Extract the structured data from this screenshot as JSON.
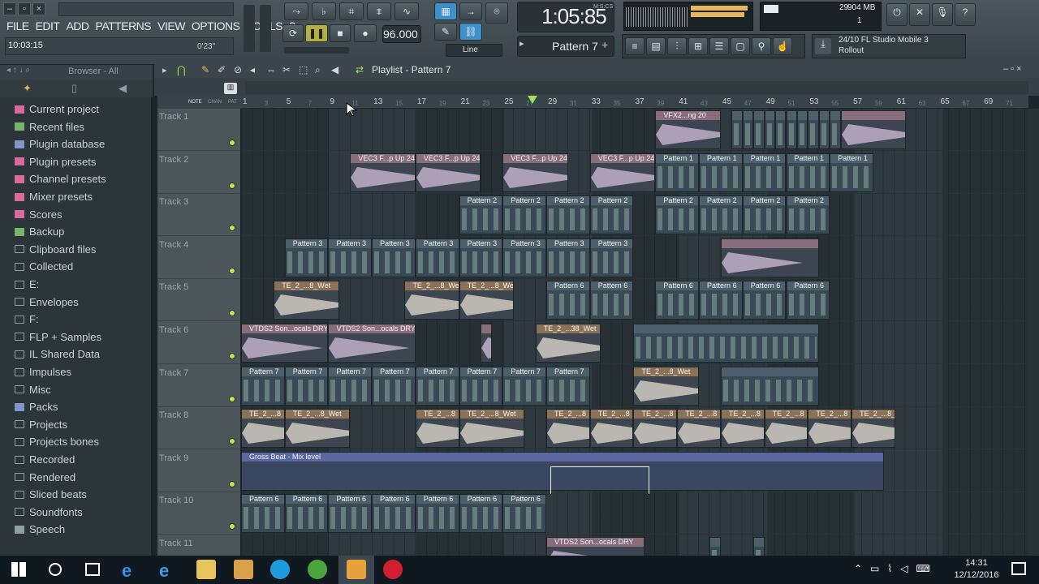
{
  "window": {
    "title": "FL Studio Mobile 3"
  },
  "menu": [
    "FILE",
    "EDIT",
    "ADD",
    "PATTERNS",
    "VIEW",
    "OPTIONS",
    "TOOLS",
    "?"
  ],
  "hint_bar": {
    "time": "10:03:15",
    "duration": "0'23\""
  },
  "transport": {
    "tempo": "96.000",
    "snap": "Line"
  },
  "clock": {
    "display": "1:05:85",
    "unit": "M:S:CS"
  },
  "pattern_selector": {
    "label": "Pattern 7"
  },
  "monitor": {
    "cpu": "29",
    "memory": "904 MB",
    "polyphony": "1"
  },
  "hint_panel": {
    "line1": "24/10  FL Studio Mobile 3",
    "line2": "Rollout"
  },
  "browser": {
    "header": "Browser - All",
    "items": [
      {
        "label": "Current project",
        "icon": "current-project-icon",
        "color": "#d96a9c"
      },
      {
        "label": "Recent files",
        "icon": "recent-files-icon",
        "color": "#7ab36c"
      },
      {
        "label": "Plugin database",
        "icon": "plugin-database-icon",
        "color": "#7f95c8"
      },
      {
        "label": "Plugin presets",
        "icon": "plugin-presets-icon",
        "color": "#d96a9c"
      },
      {
        "label": "Channel presets",
        "icon": "channel-presets-icon",
        "color": "#d96a9c"
      },
      {
        "label": "Mixer presets",
        "icon": "mixer-presets-icon",
        "color": "#d96a9c"
      },
      {
        "label": "Scores",
        "icon": "scores-icon",
        "color": "#d96a9c"
      },
      {
        "label": "Backup",
        "icon": "backup-icon",
        "color": "#7ab36c"
      },
      {
        "label": "Clipboard files",
        "icon": "folder-icon",
        "color": "#8ea0a8"
      },
      {
        "label": "Collected",
        "icon": "folder-icon",
        "color": "#8ea0a8"
      },
      {
        "label": "E:",
        "icon": "folder-icon",
        "color": "#8ea0a8"
      },
      {
        "label": "Envelopes",
        "icon": "folder-icon",
        "color": "#8ea0a8"
      },
      {
        "label": "F:",
        "icon": "folder-icon",
        "color": "#8ea0a8"
      },
      {
        "label": "FLP + Samples",
        "icon": "folder-icon",
        "color": "#8ea0a8"
      },
      {
        "label": "IL Shared Data",
        "icon": "folder-icon",
        "color": "#8ea0a8"
      },
      {
        "label": "Impulses",
        "icon": "folder-icon",
        "color": "#8ea0a8"
      },
      {
        "label": "Misc",
        "icon": "folder-icon",
        "color": "#8ea0a8"
      },
      {
        "label": "Packs",
        "icon": "packs-icon",
        "color": "#7f95c8"
      },
      {
        "label": "Projects",
        "icon": "folder-icon",
        "color": "#8ea0a8"
      },
      {
        "label": "Projects bones",
        "icon": "folder-icon",
        "color": "#8ea0a8"
      },
      {
        "label": "Recorded",
        "icon": "folder-icon",
        "color": "#8ea0a8"
      },
      {
        "label": "Rendered",
        "icon": "folder-icon",
        "color": "#8ea0a8"
      },
      {
        "label": "Sliced beats",
        "icon": "folder-icon",
        "color": "#8ea0a8"
      },
      {
        "label": "Soundfonts",
        "icon": "folder-icon",
        "color": "#8ea0a8"
      },
      {
        "label": "Speech",
        "icon": "speech-icon",
        "color": "#8ea0a8"
      }
    ]
  },
  "playlist": {
    "title": "Playlist - Pattern 7",
    "ruler_labels": [
      "NOTE",
      "CHAN",
      "PAT"
    ],
    "bars": [
      "1",
      "3",
      "5",
      "7",
      "9",
      "11",
      "13",
      "15",
      "17",
      "19",
      "21",
      "23",
      "25",
      "27",
      "29",
      "31",
      "33",
      "35",
      "37",
      "39",
      "41",
      "43",
      "45",
      "47",
      "49",
      "51",
      "53",
      "55",
      "57",
      "59",
      "61",
      "63",
      "65",
      "67",
      "69",
      "71"
    ],
    "tracks": [
      {
        "name": "Track 1",
        "clips": [
          {
            "kind": "audio",
            "label": "VFX2...ng 20",
            "start": 39,
            "len": 6
          },
          {
            "kind": "pat",
            "label": "",
            "start": 46,
            "len": 1
          },
          {
            "kind": "pat",
            "label": "",
            "start": 47,
            "len": 1
          },
          {
            "kind": "pat",
            "label": "",
            "start": 48,
            "len": 1
          },
          {
            "kind": "pat",
            "label": "",
            "start": 49,
            "len": 1
          },
          {
            "kind": "pat",
            "label": "",
            "start": 50,
            "len": 1
          },
          {
            "kind": "pat",
            "label": "",
            "start": 51,
            "len": 1
          },
          {
            "kind": "pat",
            "label": "",
            "start": 52,
            "len": 1
          },
          {
            "kind": "pat",
            "label": "",
            "start": 53,
            "len": 1
          },
          {
            "kind": "pat",
            "label": "",
            "start": 54,
            "len": 1
          },
          {
            "kind": "pat",
            "label": "",
            "start": 55,
            "len": 1
          },
          {
            "kind": "audio",
            "label": "",
            "start": 56,
            "len": 6
          }
        ]
      },
      {
        "name": "Track 2",
        "clips": [
          {
            "kind": "audio",
            "label": "VEC3 F...p Up 24",
            "start": 11,
            "len": 6
          },
          {
            "kind": "audio",
            "label": "VEC3 F...p Up 24",
            "start": 17,
            "len": 6
          },
          {
            "kind": "audio",
            "label": "VEC3 F...p Up 24",
            "start": 25,
            "len": 6
          },
          {
            "kind": "audio",
            "label": "VEC3 F...p Up 24",
            "start": 33,
            "len": 6
          },
          {
            "kind": "pat",
            "label": "Pattern 1",
            "start": 39,
            "len": 4
          },
          {
            "kind": "pat",
            "label": "Pattern 1",
            "start": 43,
            "len": 4
          },
          {
            "kind": "pat",
            "label": "Pattern 1",
            "start": 47,
            "len": 4
          },
          {
            "kind": "pat",
            "label": "Pattern 1",
            "start": 51,
            "len": 4
          },
          {
            "kind": "pat",
            "label": "Pattern 1",
            "start": 55,
            "len": 4
          }
        ]
      },
      {
        "name": "Track 3",
        "clips": [
          {
            "kind": "pat",
            "label": "Pattern 2",
            "start": 21,
            "len": 4
          },
          {
            "kind": "pat",
            "label": "Pattern 2",
            "start": 25,
            "len": 4
          },
          {
            "kind": "pat",
            "label": "Pattern 2",
            "start": 29,
            "len": 4
          },
          {
            "kind": "pat",
            "label": "Pattern 2",
            "start": 33,
            "len": 4
          },
          {
            "kind": "pat",
            "label": "Pattern 2",
            "start": 39,
            "len": 4
          },
          {
            "kind": "pat",
            "label": "Pattern 2",
            "start": 43,
            "len": 4
          },
          {
            "kind": "pat",
            "label": "Pattern 2",
            "start": 47,
            "len": 4
          },
          {
            "kind": "pat",
            "label": "Pattern 2",
            "start": 51,
            "len": 4
          }
        ]
      },
      {
        "name": "Track 4",
        "clips": [
          {
            "kind": "pat",
            "label": "Pattern 3",
            "start": 5,
            "len": 4
          },
          {
            "kind": "pat",
            "label": "Pattern 3",
            "start": 9,
            "len": 4
          },
          {
            "kind": "pat",
            "label": "Pattern 3",
            "start": 13,
            "len": 4
          },
          {
            "kind": "pat",
            "label": "Pattern 3",
            "start": 17,
            "len": 4
          },
          {
            "kind": "pat",
            "label": "Pattern 3",
            "start": 21,
            "len": 4
          },
          {
            "kind": "pat",
            "label": "Pattern 3",
            "start": 25,
            "len": 4
          },
          {
            "kind": "pat",
            "label": "Pattern 3",
            "start": 29,
            "len": 4
          },
          {
            "kind": "pat",
            "label": "Pattern 3",
            "start": 33,
            "len": 4
          },
          {
            "kind": "audio",
            "label": "",
            "start": 45,
            "len": 9
          }
        ]
      },
      {
        "name": "Track 5",
        "clips": [
          {
            "kind": "tan",
            "label": "TE_2_...8_Wet",
            "start": 4,
            "len": 6
          },
          {
            "kind": "tan",
            "label": "TE_2_...8_Wet",
            "start": 16,
            "len": 5
          },
          {
            "kind": "tan",
            "label": "TE_2_...8_Wet",
            "start": 21,
            "len": 5
          },
          {
            "kind": "pat",
            "label": "Pattern 6",
            "start": 29,
            "len": 4
          },
          {
            "kind": "pat",
            "label": "Pattern 6",
            "start": 33,
            "len": 4
          },
          {
            "kind": "pat",
            "label": "Pattern 6",
            "start": 39,
            "len": 4
          },
          {
            "kind": "pat",
            "label": "Pattern 6",
            "start": 43,
            "len": 4
          },
          {
            "kind": "pat",
            "label": "Pattern 6",
            "start": 47,
            "len": 4
          },
          {
            "kind": "pat",
            "label": "Pattern 6",
            "start": 51,
            "len": 4
          }
        ]
      },
      {
        "name": "Track 6",
        "clips": [
          {
            "kind": "audio",
            "label": "VTDS2 Son...ocals DRY",
            "start": 1,
            "len": 8
          },
          {
            "kind": "audio",
            "label": "VTDS2 Son...ocals DRY",
            "start": 9,
            "len": 8
          },
          {
            "kind": "audio",
            "label": "",
            "start": 23,
            "len": 1
          },
          {
            "kind": "tan",
            "label": "TE_2_...38_Wet",
            "start": 28,
            "len": 6
          },
          {
            "kind": "pat",
            "label": "",
            "start": 37,
            "len": 17
          }
        ]
      },
      {
        "name": "Track 7",
        "clips": [
          {
            "kind": "pat",
            "label": "Pattern 7",
            "start": 1,
            "len": 4
          },
          {
            "kind": "pat",
            "label": "Pattern 7",
            "start": 5,
            "len": 4
          },
          {
            "kind": "pat",
            "label": "Pattern 7",
            "start": 9,
            "len": 4
          },
          {
            "kind": "pat",
            "label": "Pattern 7",
            "start": 13,
            "len": 4
          },
          {
            "kind": "pat",
            "label": "Pattern 7",
            "start": 17,
            "len": 4
          },
          {
            "kind": "pat",
            "label": "Pattern 7",
            "start": 21,
            "len": 4
          },
          {
            "kind": "pat",
            "label": "Pattern 7",
            "start": 25,
            "len": 4
          },
          {
            "kind": "pat",
            "label": "Pattern 7",
            "start": 29,
            "len": 4
          },
          {
            "kind": "tan",
            "label": "TE_2_...8_Wet",
            "start": 37,
            "len": 6
          },
          {
            "kind": "pat",
            "label": "",
            "start": 45,
            "len": 9
          }
        ]
      },
      {
        "name": "Track 8",
        "clips": [
          {
            "kind": "tan",
            "label": "TE_2_...8",
            "start": 1,
            "len": 4
          },
          {
            "kind": "tan",
            "label": "TE_2_...8_Wet",
            "start": 5,
            "len": 6
          },
          {
            "kind": "tan",
            "label": "TE_2_...8",
            "start": 17,
            "len": 4
          },
          {
            "kind": "tan",
            "label": "TE_2_...8_Wet",
            "start": 21,
            "len": 6
          },
          {
            "kind": "tan",
            "label": "TE_2_...8",
            "start": 29,
            "len": 4
          },
          {
            "kind": "tan",
            "label": "TE_2_...8",
            "start": 33,
            "len": 4
          },
          {
            "kind": "tan",
            "label": "TE_2_...8",
            "start": 37,
            "len": 4
          },
          {
            "kind": "tan",
            "label": "TE_2_...8",
            "start": 41,
            "len": 4
          },
          {
            "kind": "tan",
            "label": "TE_2_...8",
            "start": 45,
            "len": 4
          },
          {
            "kind": "tan",
            "label": "TE_2_...8",
            "start": 49,
            "len": 4
          },
          {
            "kind": "tan",
            "label": "TE_2_...8",
            "start": 53,
            "len": 4
          },
          {
            "kind": "tan",
            "label": "TE_2_...8_Wet",
            "start": 57,
            "len": 4
          }
        ]
      },
      {
        "name": "Track 9",
        "clips": [
          {
            "kind": "auto",
            "label": "Gross Beat - Mix level",
            "start": 1,
            "len": 59
          }
        ]
      },
      {
        "name": "Track 10",
        "clips": [
          {
            "kind": "pat",
            "label": "Pattern 6",
            "start": 1,
            "len": 4
          },
          {
            "kind": "pat",
            "label": "Pattern 6",
            "start": 5,
            "len": 4
          },
          {
            "kind": "pat",
            "label": "Pattern 6",
            "start": 9,
            "len": 4
          },
          {
            "kind": "pat",
            "label": "Pattern 6",
            "start": 13,
            "len": 4
          },
          {
            "kind": "pat",
            "label": "Pattern 6",
            "start": 17,
            "len": 4
          },
          {
            "kind": "pat",
            "label": "Pattern 6",
            "start": 21,
            "len": 4
          },
          {
            "kind": "pat",
            "label": "Pattern 6",
            "start": 25,
            "len": 4
          }
        ]
      },
      {
        "name": "Track 11",
        "clips": [
          {
            "kind": "audio",
            "label": "VTDS2 Son...ocals DRY",
            "start": 29,
            "len": 9
          },
          {
            "kind": "pat",
            "label": "",
            "start": 44,
            "len": 1
          },
          {
            "kind": "pat",
            "label": "",
            "start": 48,
            "len": 1
          }
        ]
      }
    ]
  },
  "taskbar": {
    "time": "14:31",
    "date": "12/12/2016"
  }
}
